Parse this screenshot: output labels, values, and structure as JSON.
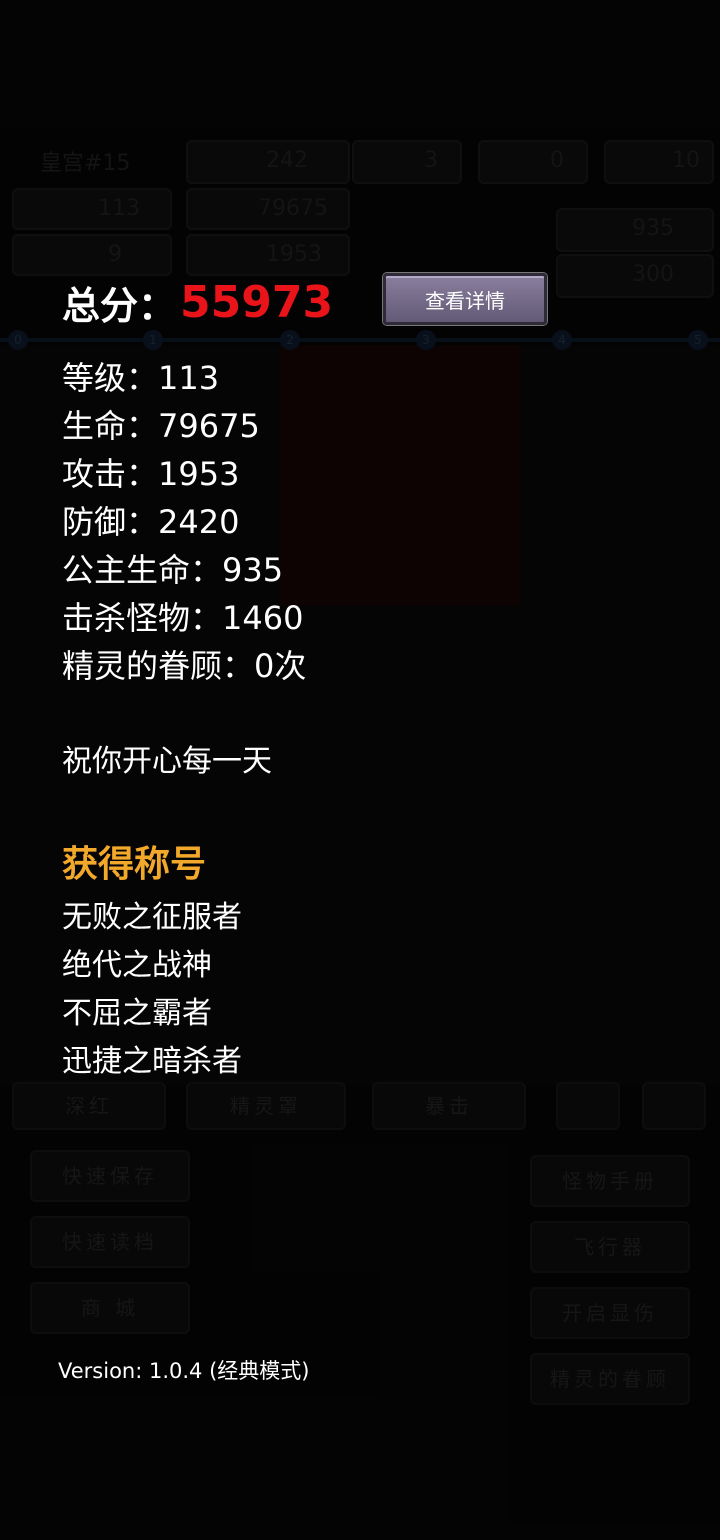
{
  "score": {
    "label": "总分：",
    "value": "55973",
    "value_color": "#e8141a"
  },
  "detail_button": {
    "label": "查看详情"
  },
  "stats": [
    {
      "label": "等级：",
      "value": "113"
    },
    {
      "label": "生命：",
      "value": "79675"
    },
    {
      "label": "攻击：",
      "value": "1953"
    },
    {
      "label": "防御：",
      "value": "2420"
    },
    {
      "label": "公主生命：",
      "value": "935"
    },
    {
      "label": "击杀怪物：",
      "value": "1460"
    },
    {
      "label": "精灵的眷顾：",
      "value": "0次"
    }
  ],
  "wish": "祝你开心每一天",
  "titles": {
    "heading": "获得称号",
    "heading_color": "#f2a82a",
    "items": [
      "无败之征服者",
      "绝代之战神",
      "不屈之霸者",
      "迅捷之暗杀者"
    ]
  },
  "version": "Version: 1.0.4 (经典模式)",
  "background": {
    "floor": "皇宫#15",
    "gold": "242",
    "keys": [
      "3",
      "0",
      "10"
    ],
    "level": "113",
    "hp": "79675",
    "exp": "9",
    "atk": "1953",
    "princess_hp": "935",
    "defense_box": "300",
    "buttons_top": [
      "深红",
      "精灵罩",
      "暴击"
    ],
    "buttons_left": [
      "快速保存",
      "快速读档",
      "商 城"
    ],
    "buttons_right": [
      "怪物手册",
      "飞行器",
      "开启显伤",
      "精灵的眷顾"
    ]
  }
}
